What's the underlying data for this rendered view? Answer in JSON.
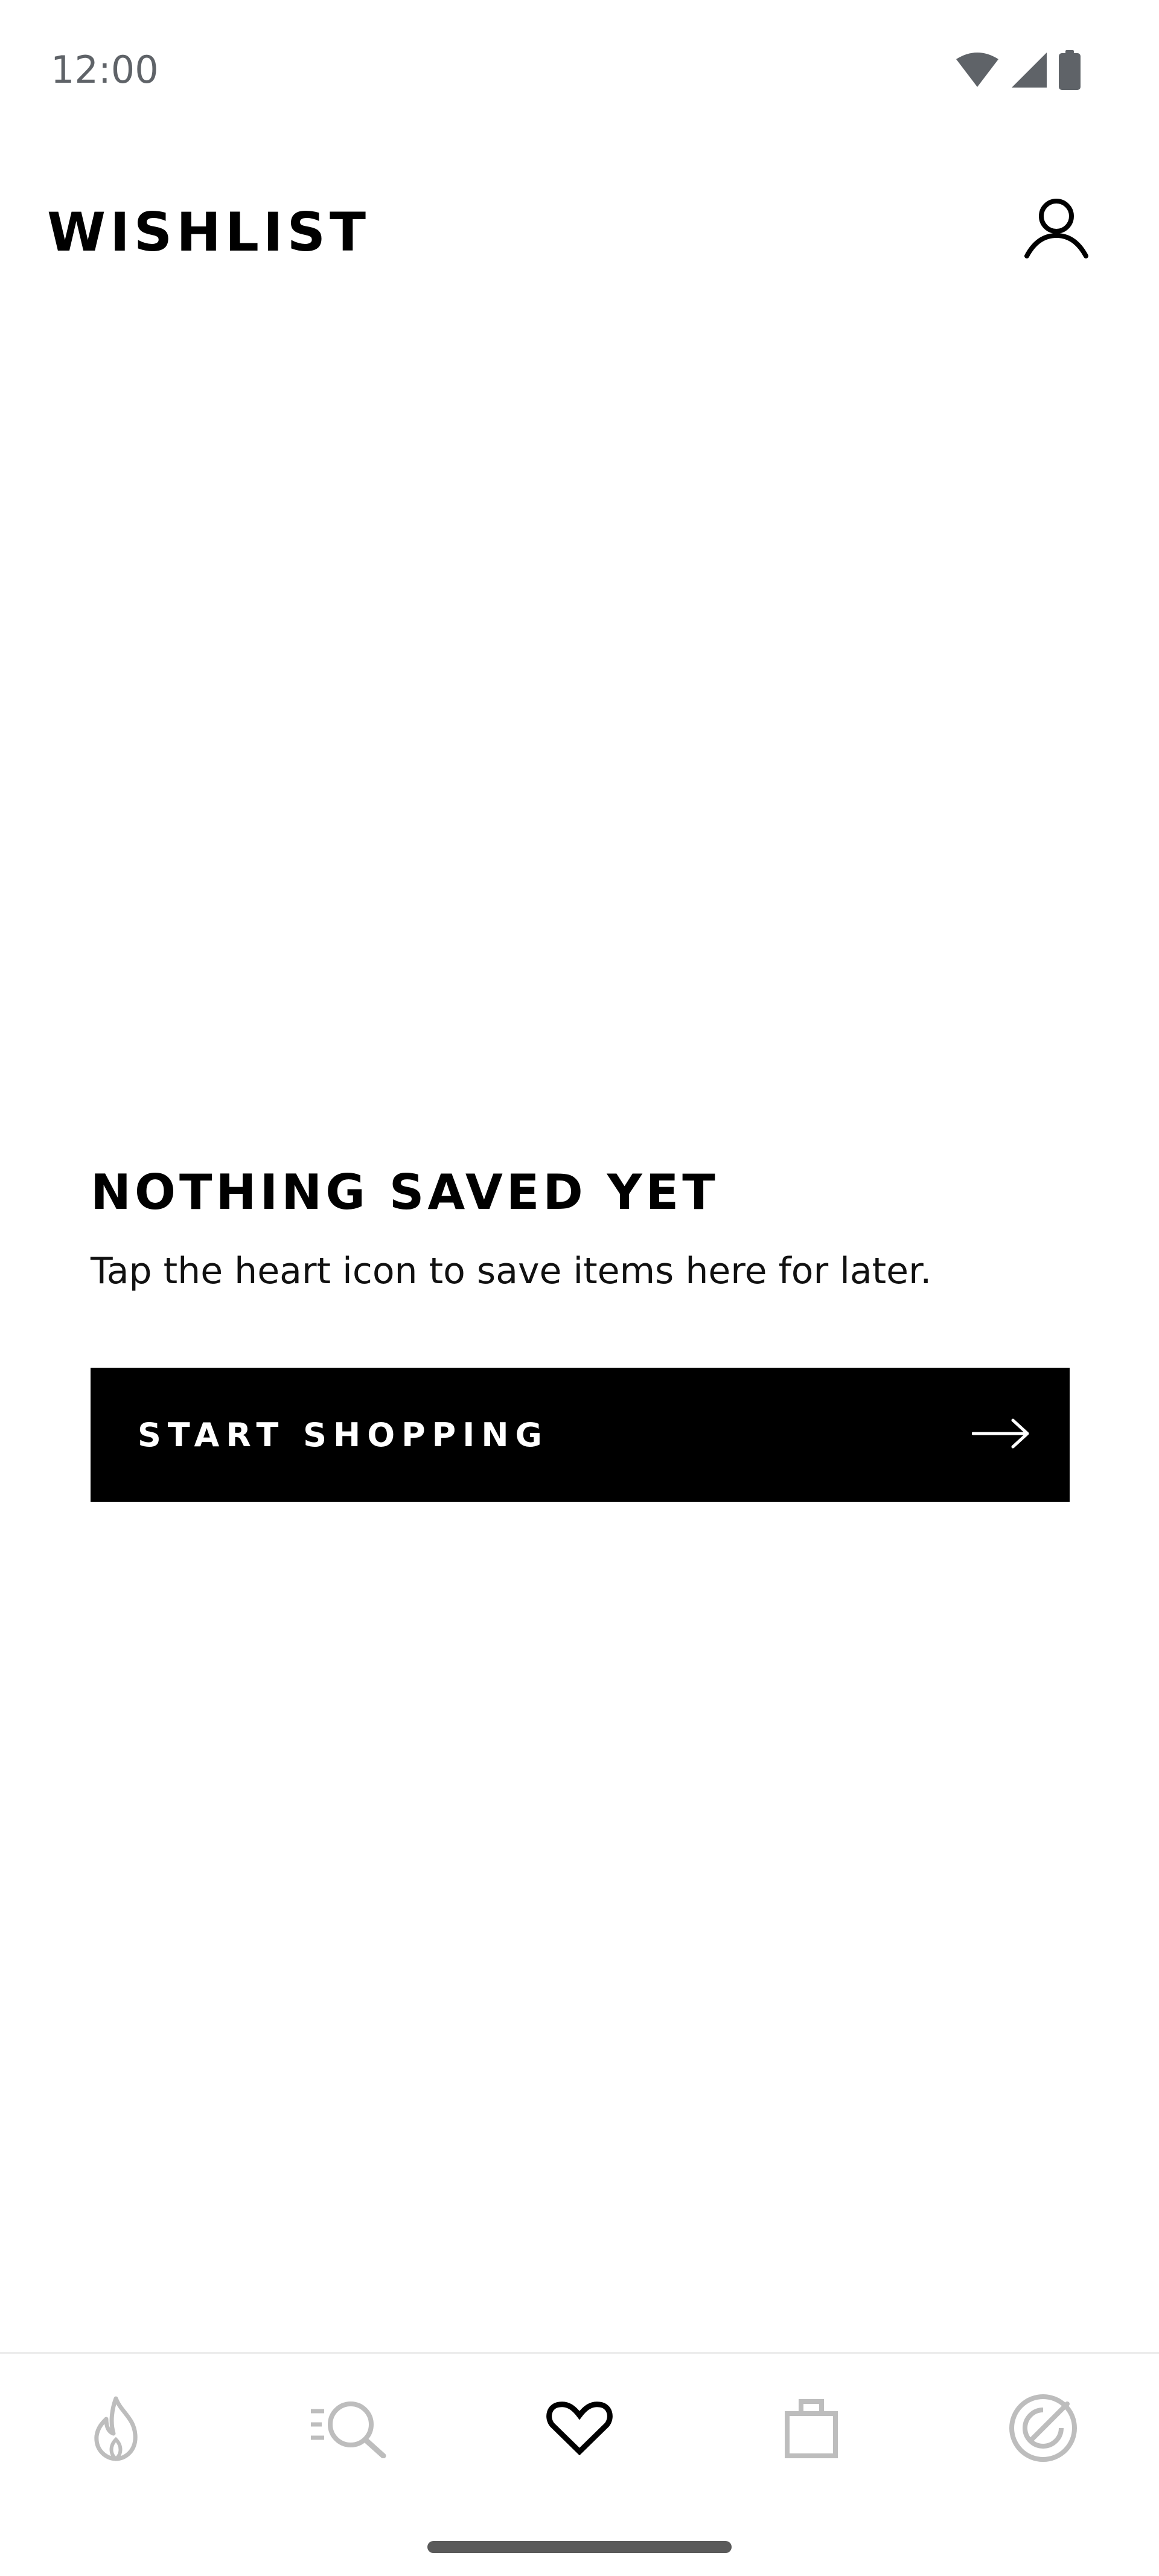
{
  "status_bar": {
    "time": "12:00",
    "icons": [
      "wifi-icon",
      "cellular-signal-icon",
      "battery-icon"
    ]
  },
  "header": {
    "title": "WISHLIST",
    "account_icon": "person-icon"
  },
  "empty_state": {
    "title": "NOTHING SAVED YET",
    "description": "Tap the heart icon to save items here for later.",
    "cta_label": "START SHOPPING",
    "cta_icon": "arrow-right-icon"
  },
  "bottom_nav": {
    "items": [
      {
        "name": "trending",
        "icon": "flame-icon",
        "active": false
      },
      {
        "name": "search",
        "icon": "search-list-icon",
        "active": false
      },
      {
        "name": "wishlist",
        "icon": "heart-icon",
        "active": true
      },
      {
        "name": "bag",
        "icon": "shopping-bag-icon",
        "active": false
      },
      {
        "name": "feed",
        "icon": "radar-icon",
        "active": false
      }
    ]
  },
  "colors": {
    "background": "#ffffff",
    "text": "#000000",
    "status_text": "#5f6368",
    "cta_background": "#000000",
    "cta_text": "#ffffff",
    "nav_inactive": "#bdbdbd",
    "nav_active": "#000000"
  }
}
